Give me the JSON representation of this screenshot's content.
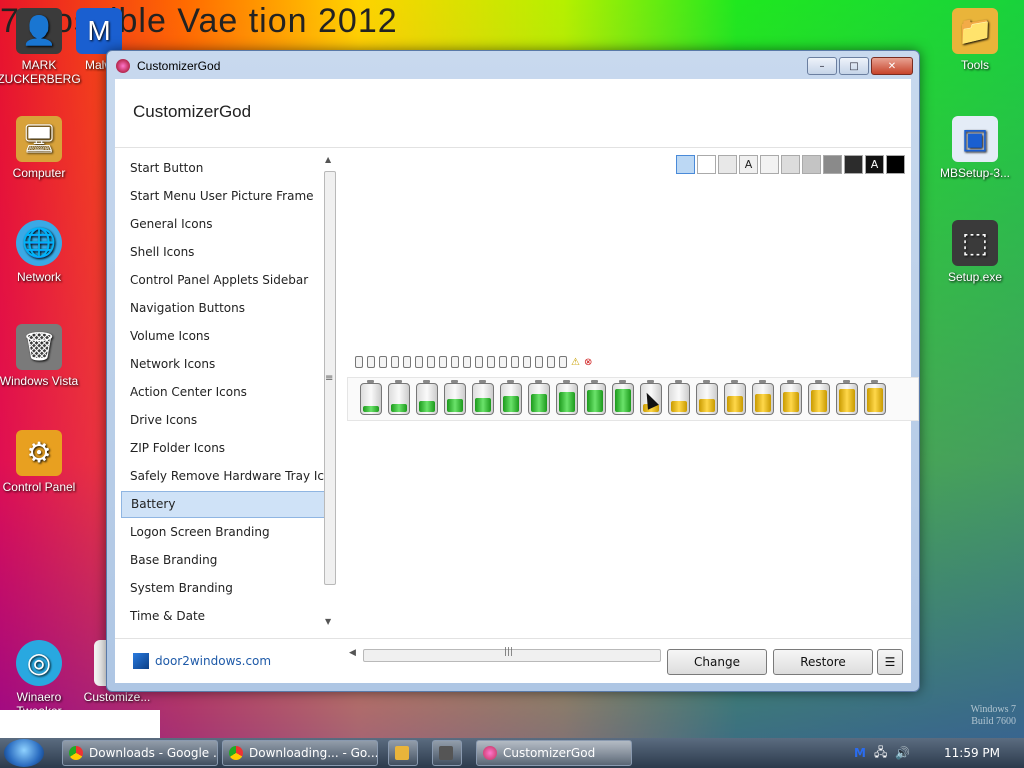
{
  "desktop": {
    "banner_text": "7 Possible Vae tion 2012",
    "icons": [
      {
        "id": "mark-zuckerberg",
        "label": "MARK ZUCKERBERG"
      },
      {
        "id": "malware",
        "label": "Malw"
      },
      {
        "id": "computer",
        "label": "Computer"
      },
      {
        "id": "network",
        "label": "Network"
      },
      {
        "id": "windows-vista",
        "label": "Windows Vista"
      },
      {
        "id": "control-panel",
        "label": "Control Panel"
      },
      {
        "id": "winaero",
        "label": "Winaero Tweaker"
      },
      {
        "id": "customize",
        "label": "Customize..."
      },
      {
        "id": "tools",
        "label": "Tools"
      },
      {
        "id": "mbsetup",
        "label": "MBSetup-3..."
      },
      {
        "id": "setup-exe",
        "label": "Setup.exe"
      }
    ],
    "watermark": [
      "Windows 7",
      "Build 7600"
    ]
  },
  "window": {
    "title": "CustomizerGod",
    "app_title": "CustomizerGod",
    "controls": {
      "minimize": "–",
      "maximize": "□",
      "close": "✕"
    },
    "sidebar": {
      "items": [
        {
          "label": "Start Button"
        },
        {
          "label": "Start Menu User Picture Frame"
        },
        {
          "label": "General Icons"
        },
        {
          "label": "Shell Icons"
        },
        {
          "label": "Control Panel Applets Sidebar"
        },
        {
          "label": "Navigation Buttons"
        },
        {
          "label": "Volume Icons"
        },
        {
          "label": "Network Icons"
        },
        {
          "label": "Action Center Icons"
        },
        {
          "label": "Drive Icons"
        },
        {
          "label": "ZIP Folder Icons"
        },
        {
          "label": "Safely Remove Hardware Tray Icon"
        },
        {
          "label": "Battery",
          "selected": true
        },
        {
          "label": "Logon Screen Branding"
        },
        {
          "label": "Base Branding"
        },
        {
          "label": "System Branding"
        },
        {
          "label": "Time & Date"
        }
      ],
      "scroll_glyphs": {
        "up": "▲",
        "down": "▼",
        "grip": "≡"
      }
    },
    "swatch_labels": [
      "",
      "",
      "",
      "A",
      "",
      "",
      "",
      "",
      "",
      "A",
      ""
    ],
    "swatch_colors": [
      "#bcd8f4",
      "#ffffff",
      "#e8e8e8",
      "#f0f0f0",
      "#f2f2f2",
      "#dcdcdc",
      "#c4c4c4",
      "#8a8a8a",
      "#2c2c2c",
      "#111111",
      "#000000"
    ],
    "tray_symbols": [
      "⚠",
      "⊗"
    ],
    "battery_levels_green": [
      0.25,
      0.35,
      0.45,
      0.55,
      0.6,
      0.65,
      0.75,
      0.85,
      0.9,
      0.95
    ],
    "battery_levels_yellow": [
      0.35,
      0.45,
      0.55,
      0.65,
      0.75,
      0.85,
      0.9,
      0.95,
      1.0
    ],
    "hscroll_glyphs": {
      "left": "◀",
      "right": "▶",
      "grip": "|||"
    },
    "footer": {
      "link": "door2windows.com",
      "change_label": "Change",
      "restore_label": "Restore",
      "menu_label": "☰"
    }
  },
  "taskbar": {
    "tasks": [
      {
        "label": "Downloads - Google ..."
      },
      {
        "label": "Downloading... - Go..."
      },
      {
        "label": "CustomizerGod",
        "active": true
      }
    ],
    "clock": "11:59 PM"
  }
}
